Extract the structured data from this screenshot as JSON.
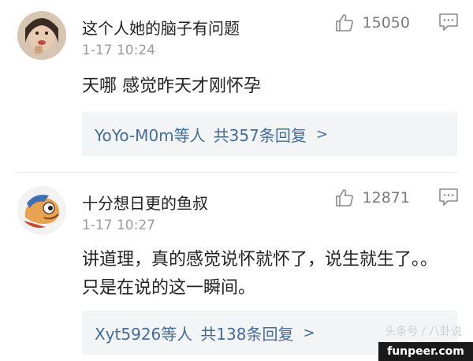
{
  "comments": [
    {
      "username": "这个人她的脑子有问题",
      "time": "1-17 10:24",
      "likes": "15050",
      "content": "天哪 感觉昨天才刚怀孕",
      "reply_users": "YoYo-M0m等人",
      "reply_count": "共357条回复",
      "reply_chevron": ">"
    },
    {
      "username": "十分想日更的鱼叔",
      "time": "1-17 10:27",
      "likes": "12871",
      "content": "讲道理，真的感觉说怀就怀了，说生就生了。。只是在说的这一瞬间。",
      "reply_users": "Xyt5926等人",
      "reply_count": "共138条回复",
      "reply_chevron": ">"
    }
  ],
  "watermark": "头条号 / 八卦说",
  "badge": "funpeer.com",
  "icons": {
    "like": "thumbs-up-icon",
    "reply": "comment-bubble-icon"
  },
  "colors": {
    "link": "#436c9b",
    "muted": "#9a9a9a",
    "reply_bg": "#f3f4f6"
  }
}
